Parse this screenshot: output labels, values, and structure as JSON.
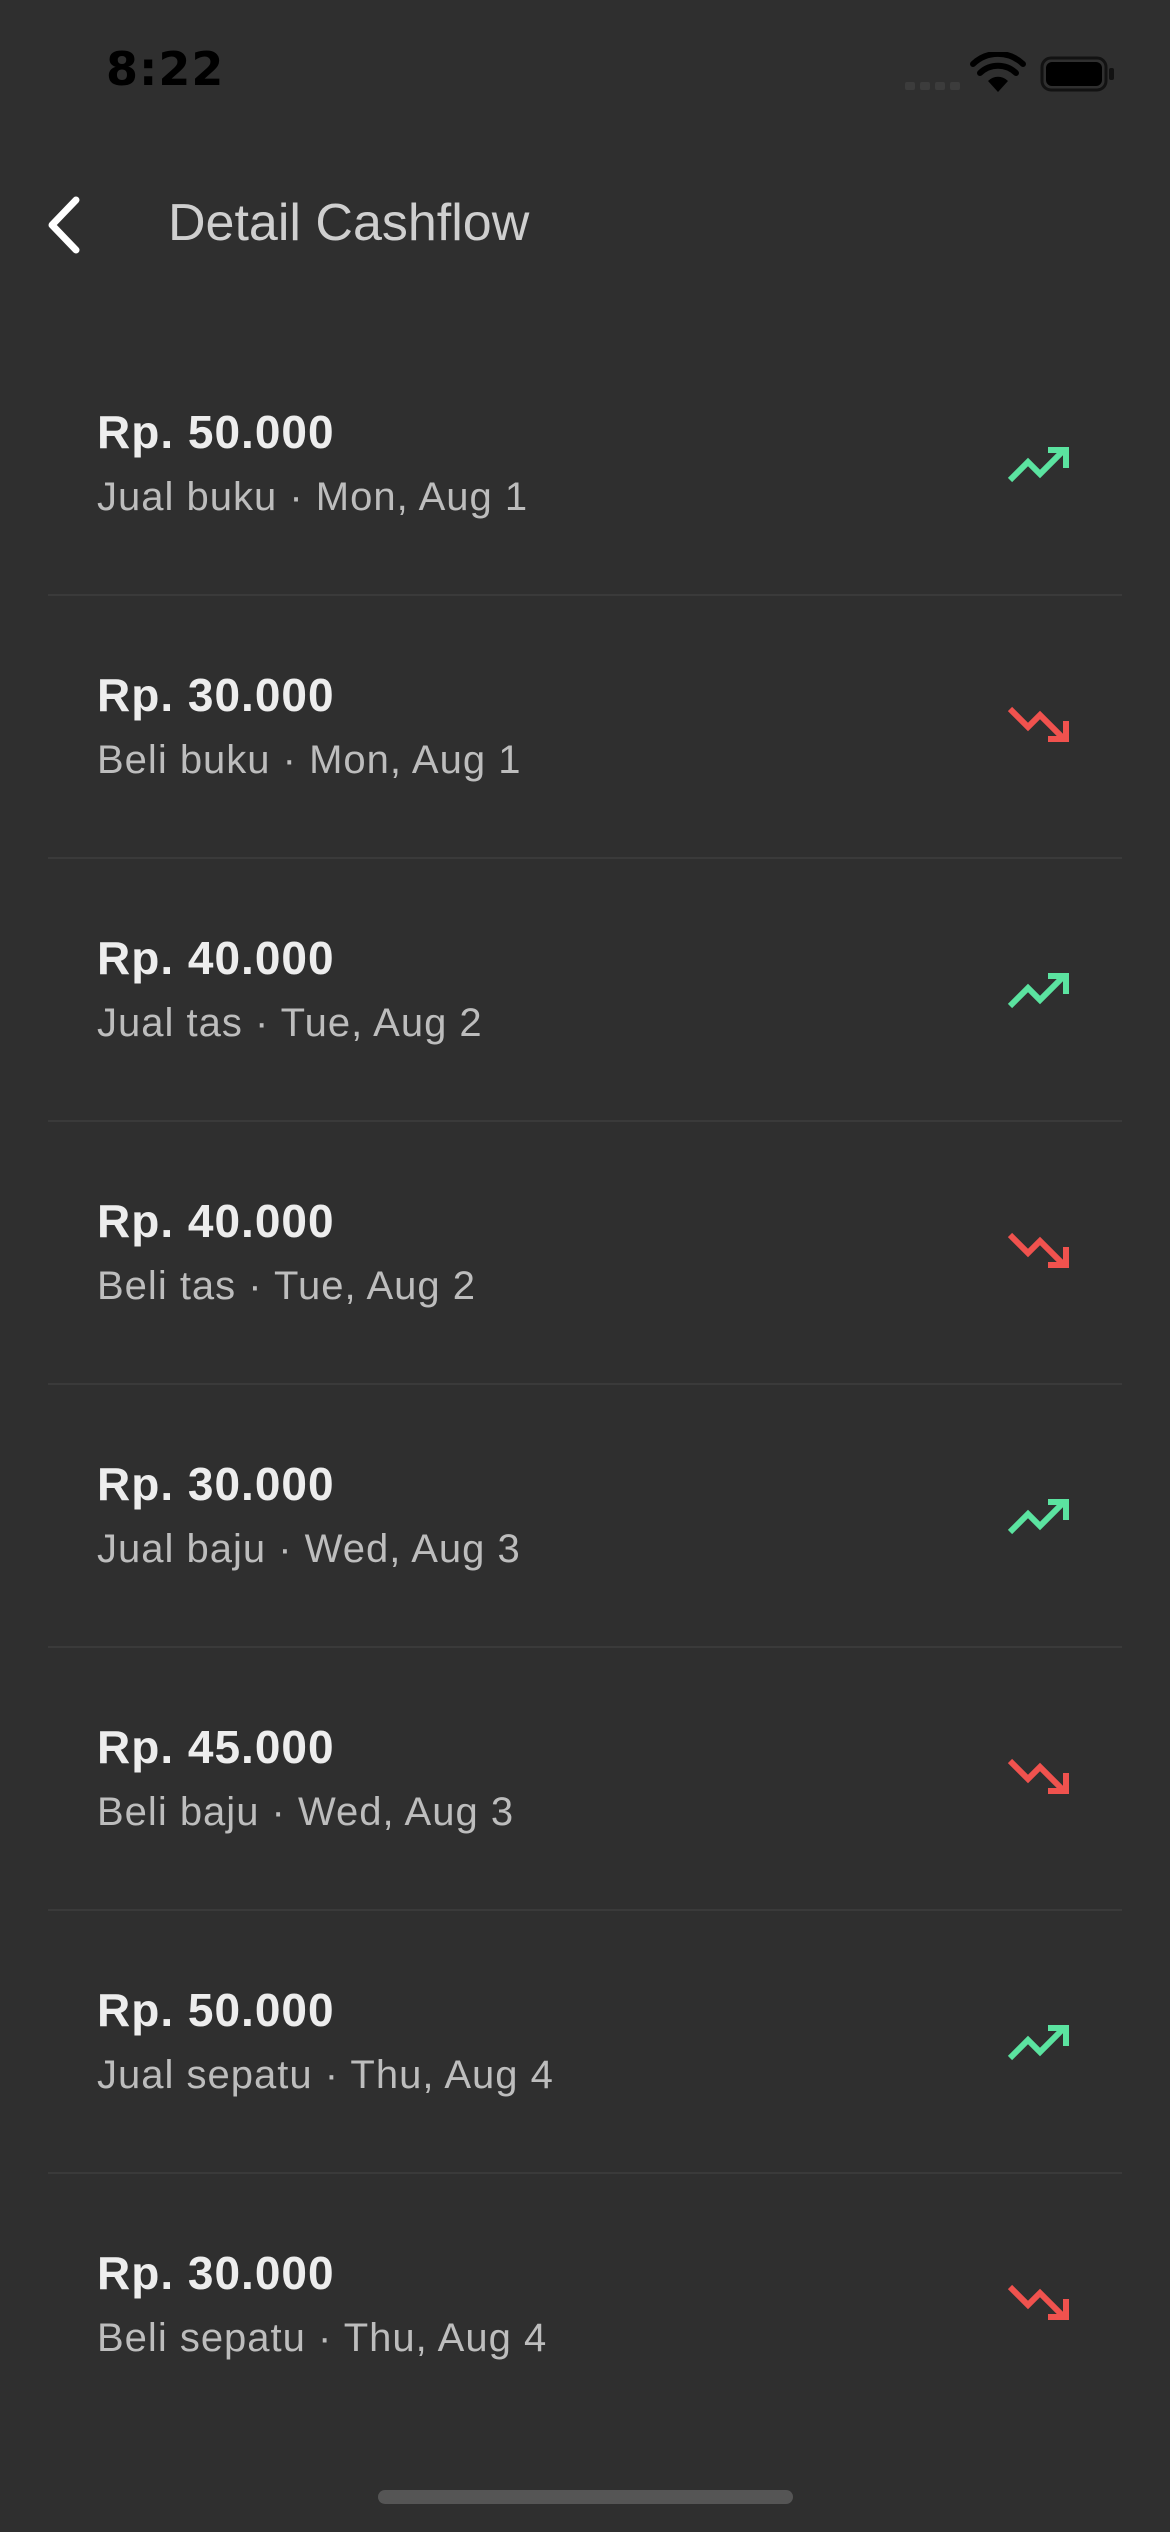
{
  "status_bar": {
    "time": "8:22"
  },
  "header": {
    "title": "Detail Cashflow",
    "back_icon": "chevron-left-icon"
  },
  "colors": {
    "background": "#2f2f2f",
    "income": "#5be3a0",
    "expense": "#f0524e"
  },
  "transactions": [
    {
      "amount": "Rp. 50.000",
      "subtitle": "Jual buku · Mon, Aug 1",
      "type": "income",
      "icon": "trending-up-icon"
    },
    {
      "amount": "Rp. 30.000",
      "subtitle": "Beli buku · Mon, Aug 1",
      "type": "expense",
      "icon": "trending-down-icon"
    },
    {
      "amount": "Rp. 40.000",
      "subtitle": "Jual tas · Tue, Aug 2",
      "type": "income",
      "icon": "trending-up-icon"
    },
    {
      "amount": "Rp. 40.000",
      "subtitle": "Beli tas · Tue, Aug 2",
      "type": "expense",
      "icon": "trending-down-icon"
    },
    {
      "amount": "Rp. 30.000",
      "subtitle": "Jual baju · Wed, Aug 3",
      "type": "income",
      "icon": "trending-up-icon"
    },
    {
      "amount": "Rp. 45.000",
      "subtitle": "Beli baju · Wed, Aug 3",
      "type": "expense",
      "icon": "trending-down-icon"
    },
    {
      "amount": "Rp. 50.000",
      "subtitle": "Jual sepatu · Thu, Aug 4",
      "type": "income",
      "icon": "trending-up-icon"
    },
    {
      "amount": "Rp. 30.000",
      "subtitle": "Beli sepatu · Thu, Aug 4",
      "type": "expense",
      "icon": "trending-down-icon"
    }
  ]
}
